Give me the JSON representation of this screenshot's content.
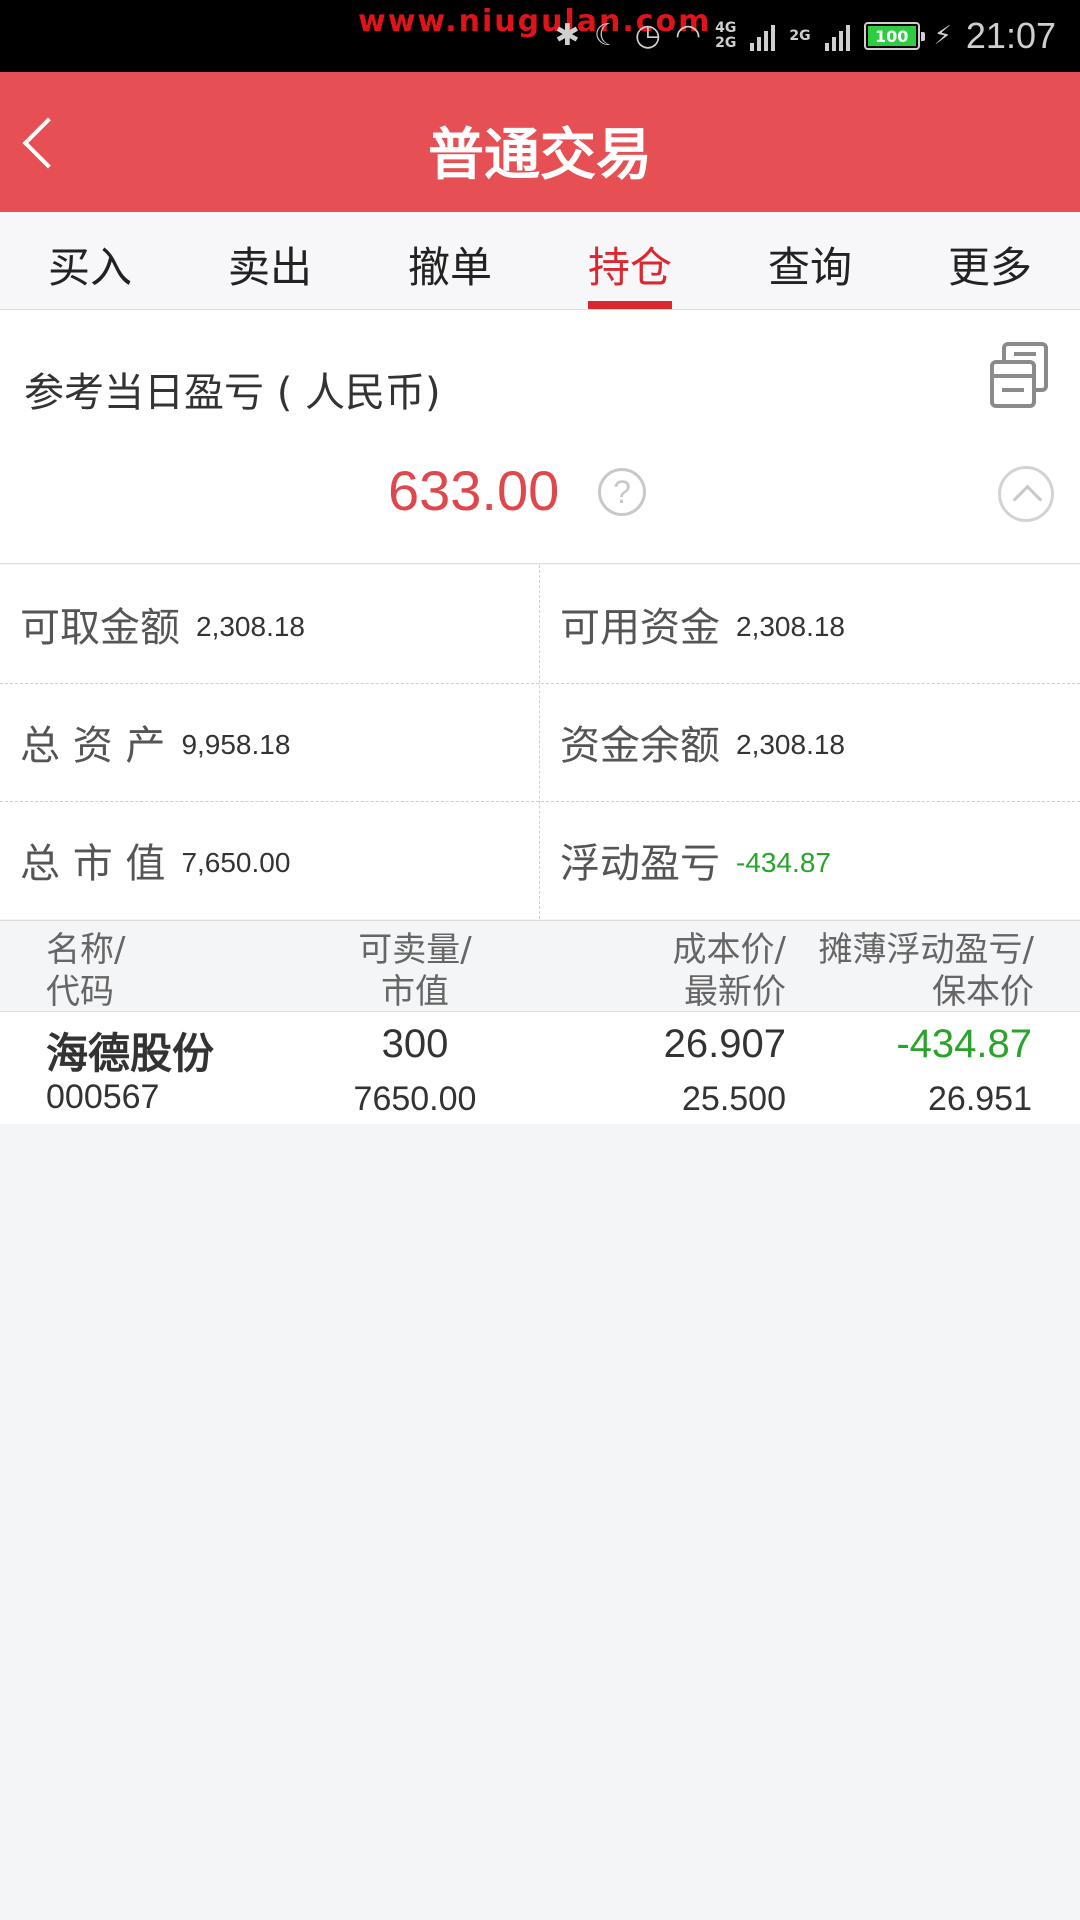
{
  "status_bar": {
    "watermark": "www.niugulan.com",
    "network_top": "4G",
    "network_bottom": "2G",
    "network2": "2G",
    "battery": "100",
    "time": "21:07"
  },
  "header": {
    "title": "普通交易"
  },
  "tabs": [
    {
      "label": "买入",
      "active": false
    },
    {
      "label": "卖出",
      "active": false
    },
    {
      "label": "撤单",
      "active": false
    },
    {
      "label": "持仓",
      "active": true
    },
    {
      "label": "查询",
      "active": false
    },
    {
      "label": "更多",
      "active": false
    }
  ],
  "pnl": {
    "title": "参考当日盈亏 ( 人民币)",
    "value": "633.00",
    "help": "?"
  },
  "summary": [
    {
      "label": "可取金额",
      "value": "2,308.18"
    },
    {
      "label": "可用资金",
      "value": "2,308.18"
    },
    {
      "label": "总 资 产",
      "value": "9,958.18"
    },
    {
      "label": "资金余额",
      "value": "2,308.18"
    },
    {
      "label": "总 市 值",
      "value": "7,650.00"
    },
    {
      "label": "浮动盈亏",
      "value": "-434.87"
    }
  ],
  "table_headers": [
    {
      "line1": "名称/",
      "line2": "代码"
    },
    {
      "line1": "可卖量/",
      "line2": "市值"
    },
    {
      "line1": "成本价/",
      "line2": "最新价"
    },
    {
      "line1": "摊薄浮动盈亏/",
      "line2": "保本价"
    }
  ],
  "positions": [
    {
      "name": "海德股份",
      "code": "000567",
      "sellable": "300",
      "market_value": "7650.00",
      "cost_price": "26.907",
      "last_price": "25.500",
      "float_pnl": "-434.87",
      "breakeven": "26.951"
    }
  ],
  "colors": {
    "header_red": "#e65054",
    "active_tab": "#d9282f",
    "profit_red": "#e0474d",
    "loss_green": "#2aa32a"
  }
}
